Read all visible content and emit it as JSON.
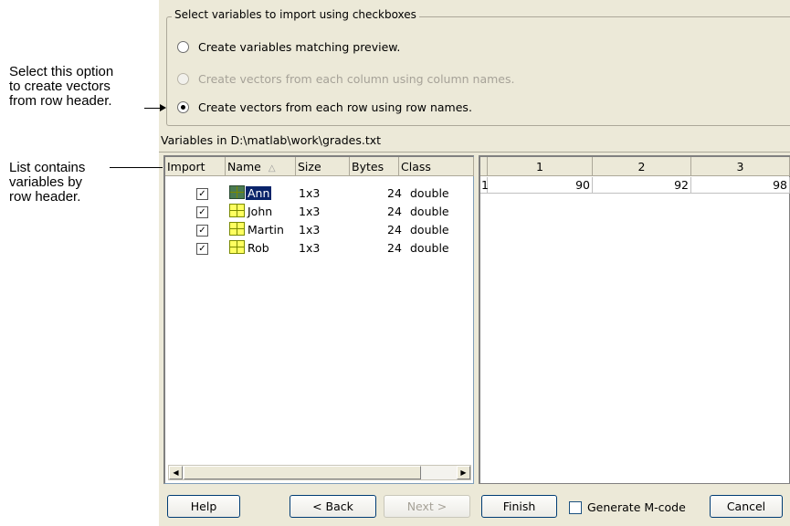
{
  "annotations": {
    "option_note": [
      "Select this option",
      "to create vectors",
      "from row header."
    ],
    "list_note": [
      "List contains",
      "variables by",
      "row header."
    ]
  },
  "group": {
    "title": "Select variables to import using checkboxes",
    "options": [
      {
        "label": "Create variables matching preview.",
        "selected": false,
        "enabled": true
      },
      {
        "label": "Create vectors from each column using column names.",
        "selected": false,
        "enabled": false
      },
      {
        "label": "Create vectors from each row using row names.",
        "selected": true,
        "enabled": true
      }
    ]
  },
  "variables_label": "Variables in D:\\matlab\\work\\grades.txt",
  "list": {
    "headers": {
      "import": "Import",
      "name": "Name",
      "sort_glyph": "△",
      "size": "Size",
      "bytes": "Bytes",
      "class": "Class"
    },
    "rows": [
      {
        "checked": "✓",
        "name": "Ann",
        "size": "1x3",
        "bytes": "24",
        "class": "double"
      },
      {
        "checked": "✓",
        "name": "John",
        "size": "1x3",
        "bytes": "24",
        "class": "double"
      },
      {
        "checked": "✓",
        "name": "Martin",
        "size": "1x3",
        "bytes": "24",
        "class": "double"
      },
      {
        "checked": "✓",
        "name": "Rob",
        "size": "1x3",
        "bytes": "24",
        "class": "double"
      }
    ]
  },
  "preview": {
    "col_headers": [
      "1",
      "2",
      "3"
    ],
    "row_header": "1",
    "values": [
      "90",
      "92",
      "98"
    ]
  },
  "scroll": {
    "left": "◀",
    "right": "▶"
  },
  "buttons": {
    "help": "Help",
    "back": "< Back",
    "next": "Next >",
    "finish": "Finish",
    "generate": "Generate M-code",
    "cancel": "Cancel"
  }
}
